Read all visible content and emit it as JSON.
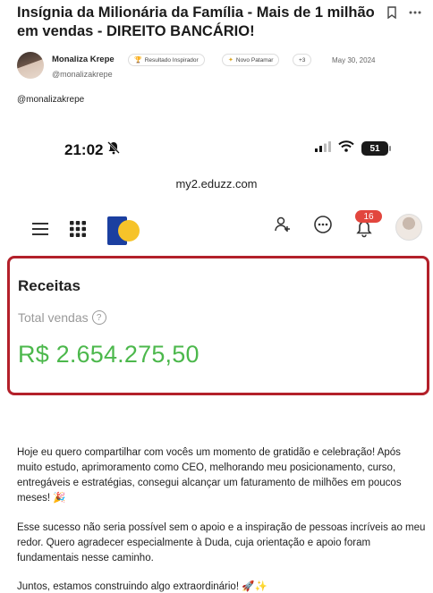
{
  "post": {
    "title": "Insígnia da Milionária da Família - Mais de 1 milhão em vendas - DIREITO BANCÁRIO!",
    "author": {
      "name": "Monaliza Krepe",
      "handle": "@monalizakrepe",
      "badges": [
        "Resultado Inspirador",
        "Novo Patamar",
        "+3"
      ],
      "date": "May 30, 2024"
    },
    "mention": "@monalizakrepe",
    "paragraphs": [
      "Hoje eu quero compartilhar com vocês um momento de gratidão e celebração! Após muito estudo, aprimoramento como CEO, melhorando meu posicionamento, curso, entregáveis e estratégias, consegui alcançar um faturamento de milhões em poucos meses! 🎉",
      "Esse sucesso não seria possível sem o apoio e a inspiração de pessoas incríveis ao meu redor. Quero agradecer especialmente à Duda, cuja orientação e apoio foram fundamentais nesse caminho.",
      "Juntos, estamos construindo algo extraordinário! 🚀✨"
    ]
  },
  "phone": {
    "time": "21:02",
    "battery": "51",
    "url": "my2.eduzz.com",
    "notifications": "16",
    "card": {
      "title": "Receitas",
      "subtitle": "Total vendas",
      "value": "R$ 2.654.275,50"
    }
  },
  "icons": {
    "bookmark": "bookmark-icon",
    "more": "more-icon",
    "bell_off": "bell-off-icon",
    "signal": "signal-icon",
    "wifi": "wifi-icon",
    "menu": "menu-icon",
    "apps": "apps-grid-icon",
    "users": "users-icon",
    "chat": "chat-icon",
    "bell": "bell-icon",
    "help": "help-icon"
  },
  "colors": {
    "value_green": "#4cb84c",
    "card_border": "#b3202a",
    "badge_red": "#e2463e",
    "logo_blue": "#1b3fa0",
    "logo_yellow": "#f6c32a"
  }
}
